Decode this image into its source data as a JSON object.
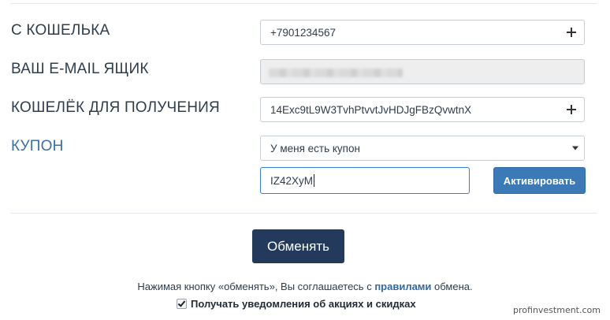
{
  "form": {
    "from_wallet": {
      "label": "С КОШЕЛЬКА",
      "value": "+7901234567"
    },
    "email": {
      "label": "ВАШ E-MAIL ЯЩИК",
      "value": ""
    },
    "receive_wallet": {
      "label": "КОШЕЛЁК ДЛЯ ПОЛУЧЕНИЯ",
      "value": "14Exc9tL9W3TvhPtvvtJvHDJgFBzQvwtnX"
    },
    "coupon": {
      "label": "КУПОН",
      "select_value": "У меня есть купон",
      "code_value": "IZ42XyM",
      "activate_label": "Активировать"
    }
  },
  "exchange_button": "Обменять",
  "terms": {
    "prefix": "Нажимая кнопку «обменять», Вы соглашаетесь с ",
    "link": "правилами",
    "suffix": " обмена."
  },
  "notifications": {
    "label": "Получать уведомления об акциях и скидках",
    "checked": true
  },
  "watermark": "profinvestment.com",
  "colors": {
    "accent": "#3b79b7",
    "dark_button": "#233a5c",
    "link": "#2f6aa6"
  }
}
